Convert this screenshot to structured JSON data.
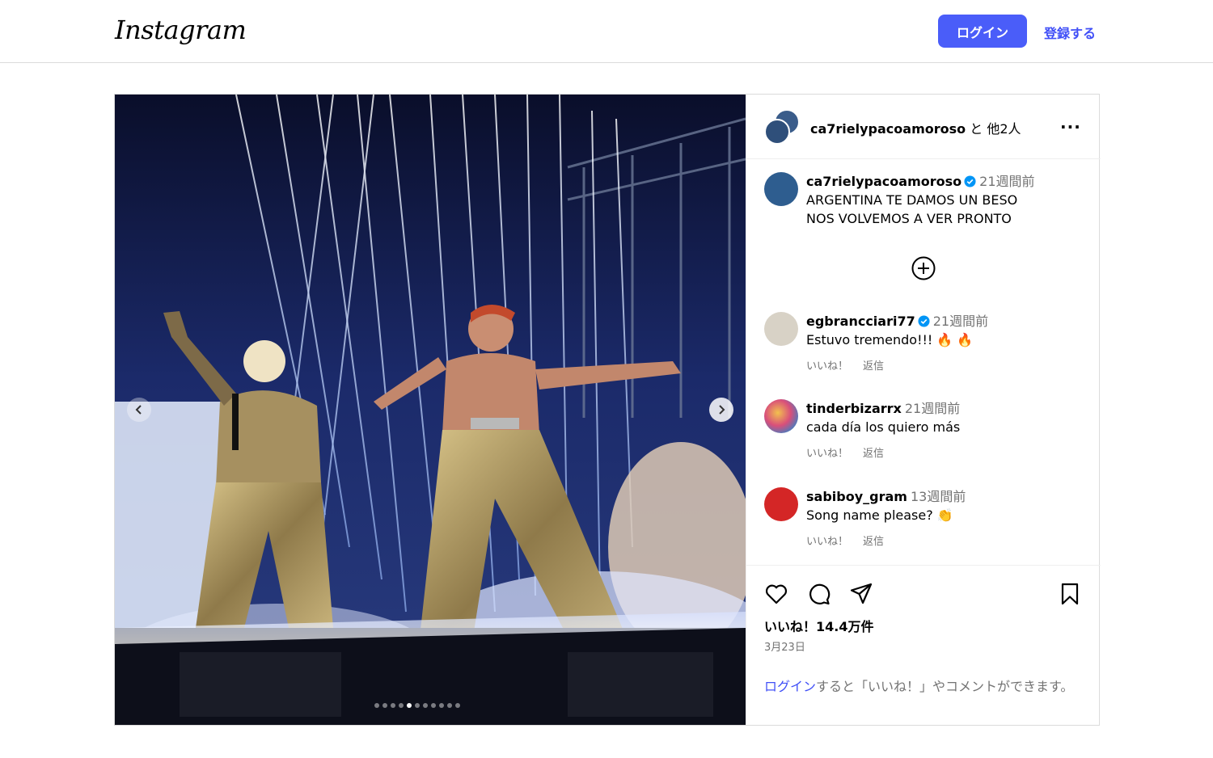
{
  "header": {
    "logo": "Instagram",
    "login_button": "ログイン",
    "signup_link": "登録する"
  },
  "post": {
    "owner": "ca7rielypacoamoroso",
    "owner_suffix": "と 他2人",
    "more_icon": "more-horizontal-icon",
    "carousel": {
      "total": 11,
      "active_index": 4
    },
    "caption": {
      "username": "ca7rielypacoamoroso",
      "verified": true,
      "time": "21週間前",
      "line1": "ARGENTINA TE DAMOS UN BESO",
      "line2": "NOS VOLVEMOS A VER PRONTO"
    },
    "load_more_icon": "plus-circle-icon",
    "comments": [
      {
        "username": "egbrancciari77",
        "verified": true,
        "time": "21週間前",
        "text": "Estuvo tremendo!!! 🔥 🔥",
        "like": "いいね！",
        "reply": "返信"
      },
      {
        "username": "tinderbizarrx",
        "verified": false,
        "time": "21週間前",
        "text": "cada día los quiero más",
        "like": "いいね！",
        "reply": "返信"
      },
      {
        "username": "sabiboy_gram",
        "verified": false,
        "time": "13週間前",
        "text": "Song name please? 👏",
        "like": "いいね！",
        "reply": "返信"
      }
    ],
    "likes": "いいね！14.4万件",
    "date": "3月23日",
    "login_prompt": {
      "link": "ログイン",
      "rest": "すると「いいね！」やコメントができます。"
    }
  },
  "colors": {
    "accent": "#4a5df9",
    "link": "#4150f7",
    "verified": "#0095f6",
    "muted": "#737373"
  }
}
